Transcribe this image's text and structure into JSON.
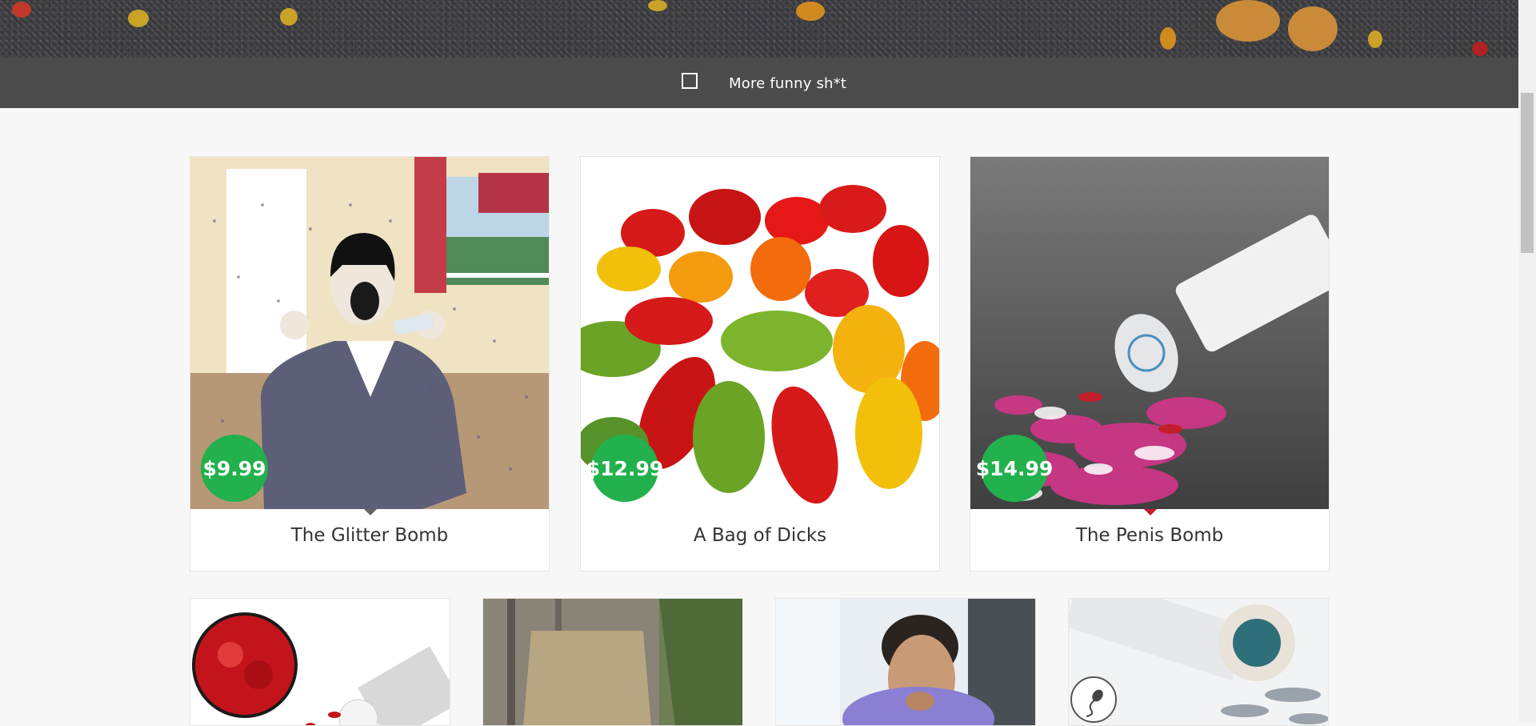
{
  "nav": {
    "label": "More funny sh*t"
  },
  "products": [
    {
      "title": "The Glitter Bomb",
      "price": "$9.99"
    },
    {
      "title": "A Bag of Dicks",
      "price": "$12.99"
    },
    {
      "title": "The Penis Bomb",
      "price": "$14.99"
    }
  ],
  "colors": {
    "price_badge": "#22b14c",
    "nav_bg": "#4b4b4b",
    "page_bg": "#f7f7f7"
  },
  "icons": {
    "menu_toggle": "checkbox-square-icon",
    "sperm_badge": "sperm-icon"
  }
}
